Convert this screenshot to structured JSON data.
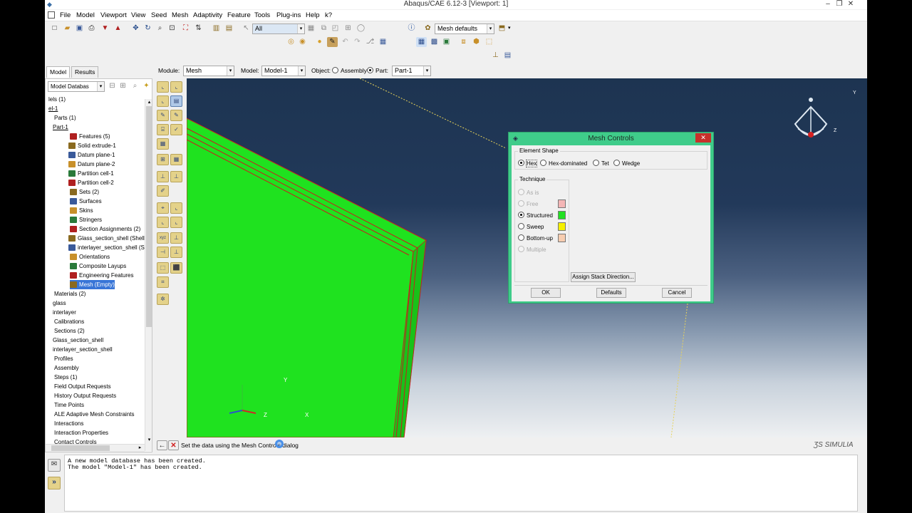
{
  "app": {
    "title": "Abaqus/CAE 6.12-3 [Viewport: 1]"
  },
  "menu": [
    "File",
    "Model",
    "Viewport",
    "View",
    "Seed",
    "Mesh",
    "Adaptivity",
    "Feature",
    "Tools",
    "Plug-ins",
    "Help",
    "k?"
  ],
  "toolbar": {
    "selection_filter": "All",
    "mesh_defaults": "Mesh defaults"
  },
  "context": {
    "module_label": "Module:",
    "module_value": "Mesh",
    "model_label": "Model:",
    "model_value": "Model-1",
    "object_label": "Object:",
    "assembly_label": "Assembly",
    "part_label": "Part:",
    "part_value": "Part-1"
  },
  "tabs": {
    "model": "Model",
    "results": "Results"
  },
  "tree": {
    "header": "Model Databas",
    "rows": [
      {
        "text": "lels (1)",
        "indent": 4
      },
      {
        "text": "el-1",
        "indent": 4
      },
      {
        "text": "Parts (1)",
        "indent": 12
      },
      {
        "text": "Part-1",
        "indent": 10
      },
      {
        "text": "Features (5)",
        "indent": 34
      },
      {
        "text": "Solid extrude-1",
        "indent": 32
      },
      {
        "text": "Datum plane-1",
        "indent": 32
      },
      {
        "text": "Datum plane-2",
        "indent": 32
      },
      {
        "text": "Partition cell-1",
        "indent": 32
      },
      {
        "text": "Partition cell-2",
        "indent": 32
      },
      {
        "text": "Sets (2)",
        "indent": 34
      },
      {
        "text": "Surfaces",
        "indent": 34
      },
      {
        "text": "Skins",
        "indent": 34
      },
      {
        "text": "Stringers",
        "indent": 34
      },
      {
        "text": "Section Assignments (2)",
        "indent": 34
      },
      {
        "text": "Glass_section_shell (Shell, Ho",
        "indent": 32
      },
      {
        "text": "interlayer_section_shell (Shell",
        "indent": 32
      },
      {
        "text": "Orientations",
        "indent": 34
      },
      {
        "text": "Composite Layups",
        "indent": 34
      },
      {
        "text": "Engineering Features",
        "indent": 34
      },
      {
        "text": "Mesh (Empty)",
        "indent": 34
      },
      {
        "text": "Materials (2)",
        "indent": 12
      },
      {
        "text": "glass",
        "indent": 10
      },
      {
        "text": "interlayer",
        "indent": 10
      },
      {
        "text": "Calibrations",
        "indent": 12
      },
      {
        "text": "Sections (2)",
        "indent": 12
      },
      {
        "text": "Glass_section_shell",
        "indent": 10
      },
      {
        "text": "interlayer_section_shell",
        "indent": 10
      },
      {
        "text": "Profiles",
        "indent": 12
      },
      {
        "text": "Assembly",
        "indent": 12
      },
      {
        "text": "Steps (1)",
        "indent": 12
      },
      {
        "text": "Field Output Requests",
        "indent": 12
      },
      {
        "text": "History Output Requests",
        "indent": 12
      },
      {
        "text": "Time Points",
        "indent": 12
      },
      {
        "text": "ALE Adaptive Mesh Constraints",
        "indent": 12
      },
      {
        "text": "Interactions",
        "indent": 12
      },
      {
        "text": "Interaction Properties",
        "indent": 12
      },
      {
        "text": "Contact Controls",
        "indent": 12
      }
    ]
  },
  "prompt": {
    "text": "Set the data using the Mesh Controls dialog"
  },
  "messages": {
    "line1": "A new model database has been created.",
    "line2": "The model \"Model-1\" has been created."
  },
  "viewport": {
    "brand": "SIMULIA",
    "axis_x": "X",
    "axis_y": "Y",
    "axis_z": "Z"
  },
  "dialog": {
    "title": "Mesh Controls",
    "element_shape_label": "Element Shape",
    "shapes": [
      "Hex",
      "Hex-dominated",
      "Tet",
      "Wedge"
    ],
    "technique_label": "Technique",
    "techniques": {
      "as_is": "As is",
      "free": "Free",
      "structured": "Structured",
      "sweep": "Sweep",
      "bottom_up": "Bottom-up",
      "multiple": "Multiple"
    },
    "colors": {
      "free": "#f4b6b6",
      "structured": "#22e022",
      "sweep": "#f5f000",
      "bottom_up": "#f7cdb0"
    },
    "assign_stack": "Assign Stack Direction...",
    "ok": "OK",
    "defaults": "Defaults",
    "cancel": "Cancel"
  }
}
